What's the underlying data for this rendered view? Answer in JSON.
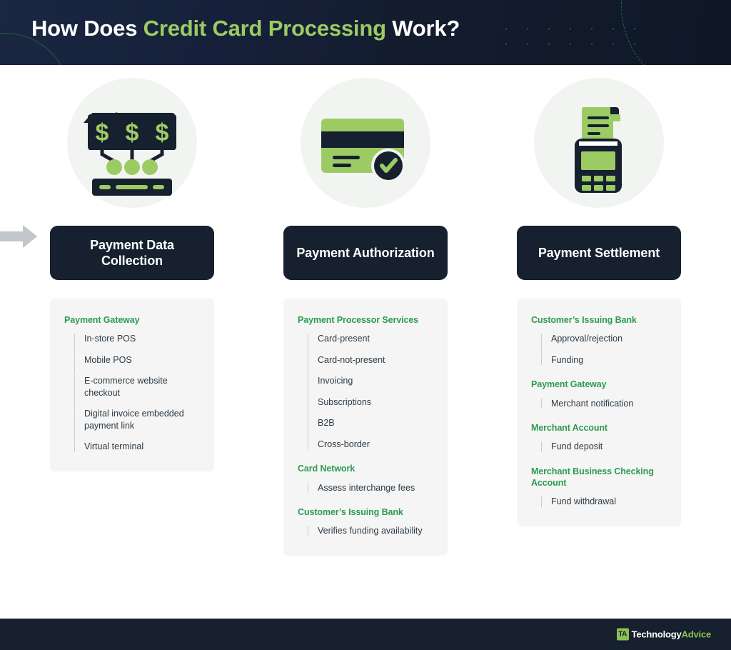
{
  "header": {
    "title_prefix": "How Does ",
    "title_accent": "Credit Card Processing",
    "title_suffix": " Work?",
    "bg_color": "#16203a",
    "accent_color": "#9ccb63"
  },
  "theme": {
    "navy": "#16202e",
    "green_bright": "#9ccb63",
    "green_heading": "#2f9a52",
    "panel_bg": "#f4f5f4",
    "circle_bg": "#f2f4f2",
    "arrow_gray": "#c3c7cc",
    "body_text": "#2f3a46"
  },
  "steps": [
    {
      "icon": "price-tags-payment-icon",
      "title": "Payment Data Collection",
      "groups": [
        {
          "title": "Payment Gateway",
          "items": [
            "In-store POS",
            "Mobile POS",
            "E-commerce website checkout",
            "Digital invoice embedded payment link",
            "Virtual terminal"
          ]
        }
      ]
    },
    {
      "icon": "credit-card-approved-icon",
      "title": "Payment Authorization",
      "groups": [
        {
          "title": "Payment Processor Services",
          "items": [
            "Card-present",
            "Card-not-present",
            "Invoicing",
            "Subscriptions",
            "B2B",
            "Cross-border"
          ]
        },
        {
          "title": "Card Network",
          "items": [
            "Assess interchange fees"
          ]
        },
        {
          "title": "Customer’s Issuing Bank",
          "items": [
            "Verifies funding availability"
          ]
        }
      ]
    },
    {
      "icon": "pos-terminal-receipt-icon",
      "title": "Payment Settlement",
      "groups": [
        {
          "title": "Customer’s Issuing Bank",
          "items": [
            "Approval/rejection",
            "Funding"
          ]
        },
        {
          "title": "Payment Gateway",
          "items": [
            "Merchant notification"
          ]
        },
        {
          "title": "Merchant Account",
          "items": [
            "Fund deposit"
          ]
        },
        {
          "title": "Merchant Business Checking Account",
          "items": [
            "Fund withdrawal"
          ]
        }
      ]
    }
  ],
  "arrows": [
    {
      "name": "arrow-step1-to-step2"
    },
    {
      "name": "arrow-step2-to-step3"
    }
  ],
  "footer": {
    "brand_mark": "TA",
    "brand_primary": "Technology",
    "brand_secondary": "Advice"
  }
}
